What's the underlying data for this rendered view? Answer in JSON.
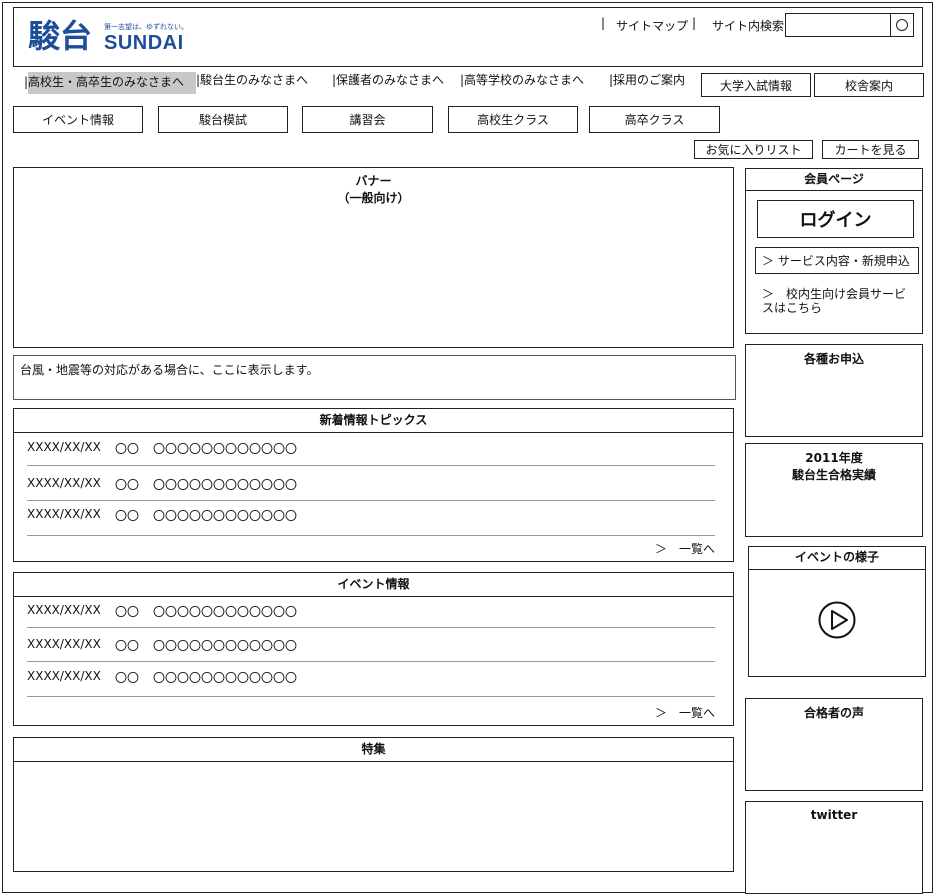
{
  "header": {
    "logo_kanji": "駿台",
    "logo_latin": "SUNDAI",
    "logo_tagline": "第一志望は、ゆずれない。",
    "sitemap": "サイトマップ",
    "search_label": "サイト内検索",
    "search_value": "",
    "brand_color": "#1d4e9a"
  },
  "nav": {
    "items": [
      {
        "label": "高校生・高卒生のみなさまへ"
      },
      {
        "label": "駿台生のみなさまへ"
      },
      {
        "label": "保護者のみなさまへ"
      },
      {
        "label": "高等学校のみなさまへ"
      },
      {
        "label": "採用のご案内"
      }
    ],
    "buttons": [
      "大学入試情報",
      "校舎案内"
    ]
  },
  "categories": [
    "イベント情報",
    "駿台模試",
    "講習会",
    "高校生クラス",
    "高卒クラス"
  ],
  "utility": {
    "favorites": "お気に入りリスト",
    "cart": "カートを見る"
  },
  "banner": {
    "line1": "バナー",
    "line2": "（一般向け）"
  },
  "alert": {
    "text": "台風・地震等の対応がある場合に、ここに表示します。"
  },
  "news": {
    "title": "新着情報トピックス",
    "rows": [
      {
        "date": "XXXX/XX/XX",
        "cat": "〇〇",
        "text": "〇〇〇〇〇〇〇〇〇〇〇〇"
      },
      {
        "date": "XXXX/XX/XX",
        "cat": "〇〇",
        "text": "〇〇〇〇〇〇〇〇〇〇〇〇"
      },
      {
        "date": "XXXX/XX/XX",
        "cat": "〇〇",
        "text": "〇〇〇〇〇〇〇〇〇〇〇〇"
      }
    ],
    "more": "＞　一覧へ"
  },
  "events": {
    "title": "イベント情報",
    "rows": [
      {
        "date": "XXXX/XX/XX",
        "cat": "〇〇",
        "text": "〇〇〇〇〇〇〇〇〇〇〇〇"
      },
      {
        "date": "XXXX/XX/XX",
        "cat": "〇〇",
        "text": "〇〇〇〇〇〇〇〇〇〇〇〇"
      },
      {
        "date": "XXXX/XX/XX",
        "cat": "〇〇",
        "text": "〇〇〇〇〇〇〇〇〇〇〇〇"
      }
    ],
    "more": "＞　一覧へ"
  },
  "feature": {
    "title": "特集"
  },
  "sidebar": {
    "member_title": "会員ページ",
    "login": "ログイン",
    "service_link": "＞ サービス内容・新規申込",
    "internal_link": "＞　校内生向け会員サービスはこちら",
    "apply_title": "各種お申込",
    "results_title_1": "2011年度",
    "results_title_2": "駿台生合格実績",
    "event_scene_title": "イベントの様子",
    "voices_title": "合格者の声",
    "twitter_title": "twitter"
  }
}
